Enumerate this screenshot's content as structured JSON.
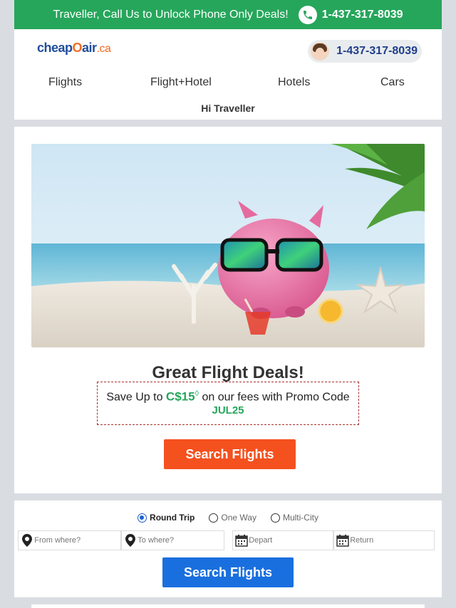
{
  "topbar": {
    "promo_text": "Traveller, Call Us to Unlock Phone Only Deals!",
    "phone": "1-437-317-8039",
    "icon": "phone-icon"
  },
  "header": {
    "logo": {
      "part1": "cheap",
      "part2": "O",
      "part3": "air",
      "part4": ".ca"
    },
    "call_phone": "1-437-317-8039",
    "nav": [
      "Flights",
      "Flight+Hotel",
      "Hotels",
      "Cars"
    ],
    "greeting": "Hi Traveller"
  },
  "deals": {
    "title": "Great Flight Deals!",
    "save_prefix": "Save Up to",
    "amount": "C$15",
    "amount_mark": "◊",
    "save_suffix": "on our fees with Promo Code",
    "code": "JUL25",
    "button": "Search Flights"
  },
  "search": {
    "trip_types": [
      {
        "label": "Round Trip",
        "selected": true
      },
      {
        "label": "One Way",
        "selected": false
      },
      {
        "label": "Multi-City",
        "selected": false
      }
    ],
    "from_placeholder": "From where?",
    "to_placeholder": "To where?",
    "depart_placeholder": "Depart",
    "return_placeholder": "Return",
    "button": "Search Flights"
  },
  "colors": {
    "green": "#26a65b",
    "orange": "#f4511e",
    "blue": "#1a6fde",
    "brand_blue": "#1f4e9c"
  }
}
